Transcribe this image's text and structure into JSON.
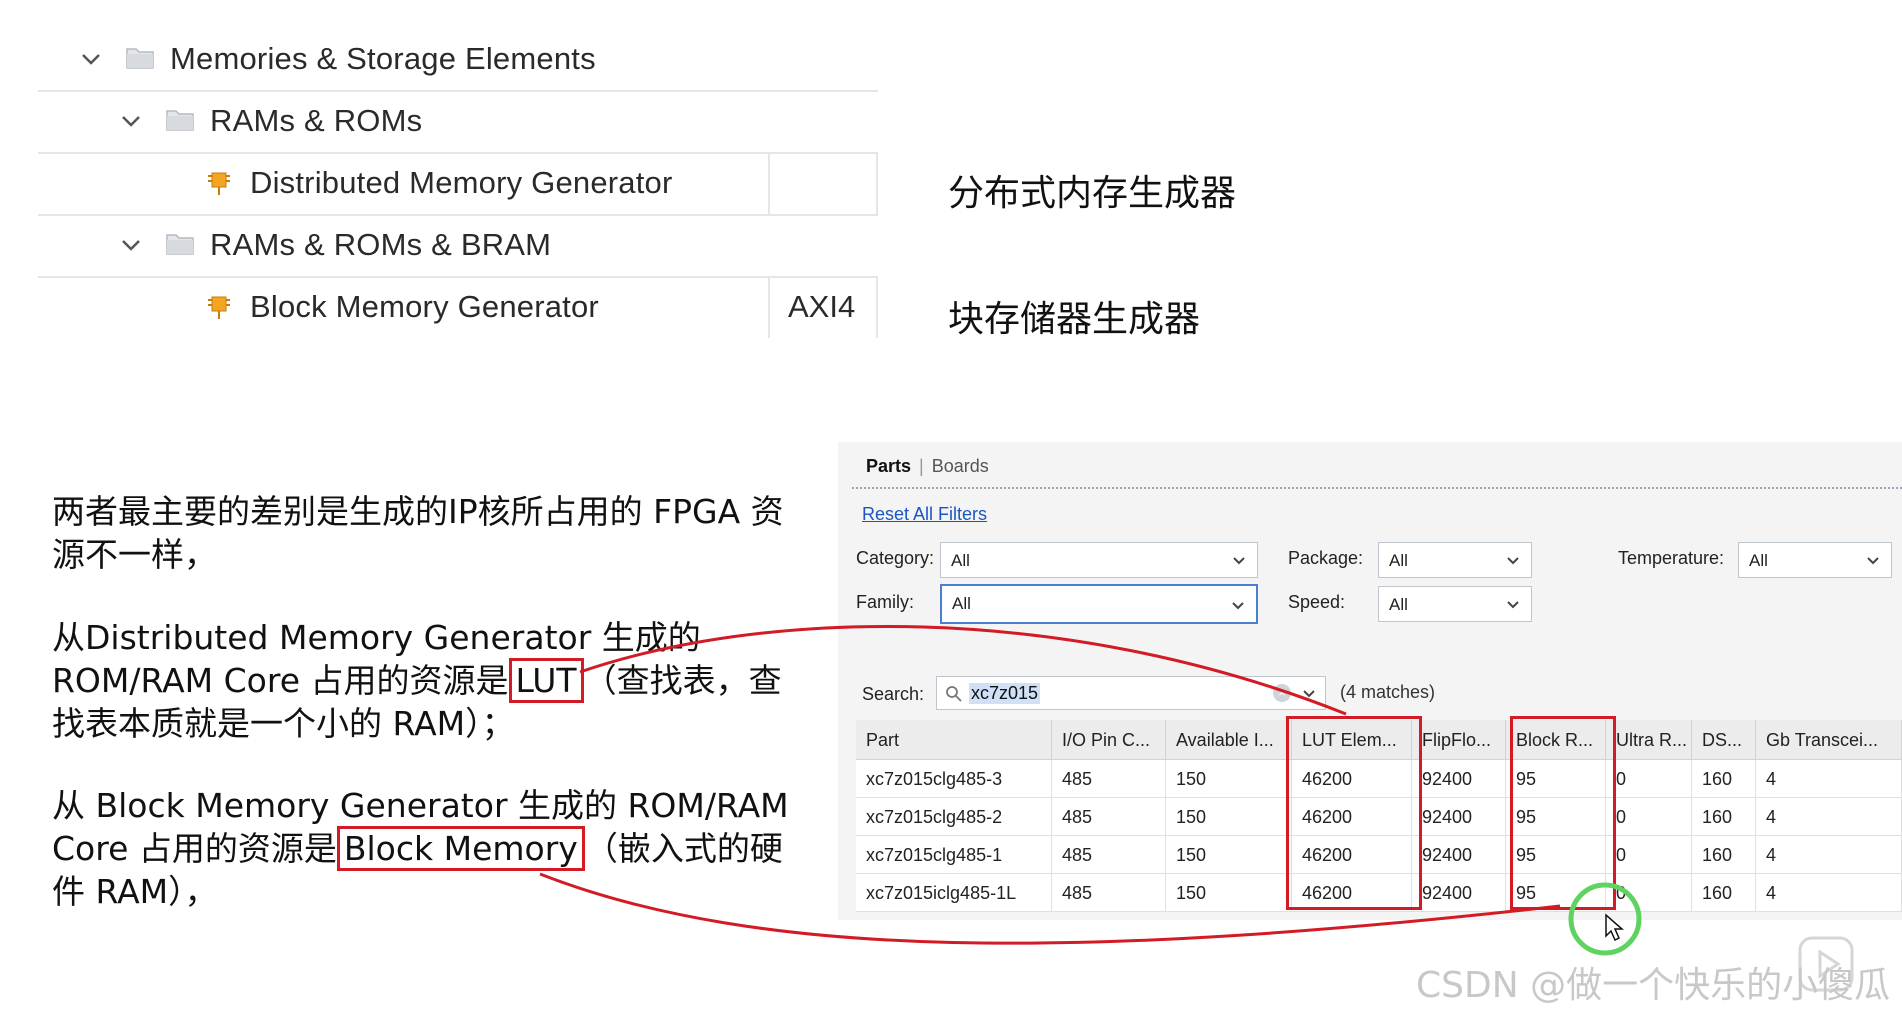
{
  "tree": {
    "rows": [
      {
        "label": "Memories & Storage Elements"
      },
      {
        "label": "RAMs & ROMs"
      },
      {
        "label": "Distributed Memory Generator",
        "interface": ""
      },
      {
        "label": "RAMs & ROMs & BRAM"
      },
      {
        "label": "Block Memory Generator",
        "interface": "AXI4"
      }
    ]
  },
  "annotations": {
    "distributed_cn": "分布式内存生成器",
    "block_cn": "块存储器生成器"
  },
  "explanation": {
    "p1": "两者最主要的差别是生成的IP核所占用的 FPGA 资源不一样，",
    "p2_prefix": "从Distributed Memory Generator 生成的 ROM/RAM Core 占用的资源是",
    "p2_box": "LUT",
    "p2_suffix": "（查找表，查找表本质就是一个小的 RAM）；",
    "p3_prefix": "从 Block Memory Generator 生成的 ROM/RAM Core 占用的资源是",
    "p3_box": "Block Memory",
    "p3_suffix": "（嵌入式的硬件 RAM），"
  },
  "parts_dialog": {
    "tabs": {
      "parts": "Parts",
      "separator": "|",
      "boards": "Boards"
    },
    "reset_link": "Reset All Filters",
    "filters": {
      "category": {
        "label": "Category:",
        "value": "All"
      },
      "family": {
        "label": "Family:",
        "value": "All"
      },
      "package": {
        "label": "Package:",
        "value": "All"
      },
      "speed": {
        "label": "Speed:",
        "value": "All"
      },
      "temperature": {
        "label": "Temperature:",
        "value": "All"
      }
    },
    "search": {
      "label": "Search:",
      "value": "xc7z015",
      "matches": "(4 matches)"
    },
    "columns": [
      "Part",
      "I/O Pin C...",
      "Available I...",
      "LUT Elem...",
      "FlipFlo...",
      "Block R...",
      "Ultra R...",
      "DS...",
      "Gb Transcei..."
    ],
    "rows": [
      [
        "xc7z015clg485-3",
        "485",
        "150",
        "46200",
        "92400",
        "95",
        "0",
        "160",
        "4"
      ],
      [
        "xc7z015clg485-2",
        "485",
        "150",
        "46200",
        "92400",
        "95",
        "0",
        "160",
        "4"
      ],
      [
        "xc7z015clg485-1",
        "485",
        "150",
        "46200",
        "92400",
        "95",
        "0",
        "160",
        "4"
      ],
      [
        "xc7z015iclg485-1L",
        "485",
        "150",
        "46200",
        "92400",
        "95",
        "0",
        "160",
        "4"
      ]
    ]
  },
  "watermark": "CSDN @做一个快乐的小傻瓜",
  "colors": {
    "highlight_red": "#d21b24",
    "link_blue": "#1a56c2",
    "cursor_ring": "#5fd35f"
  }
}
